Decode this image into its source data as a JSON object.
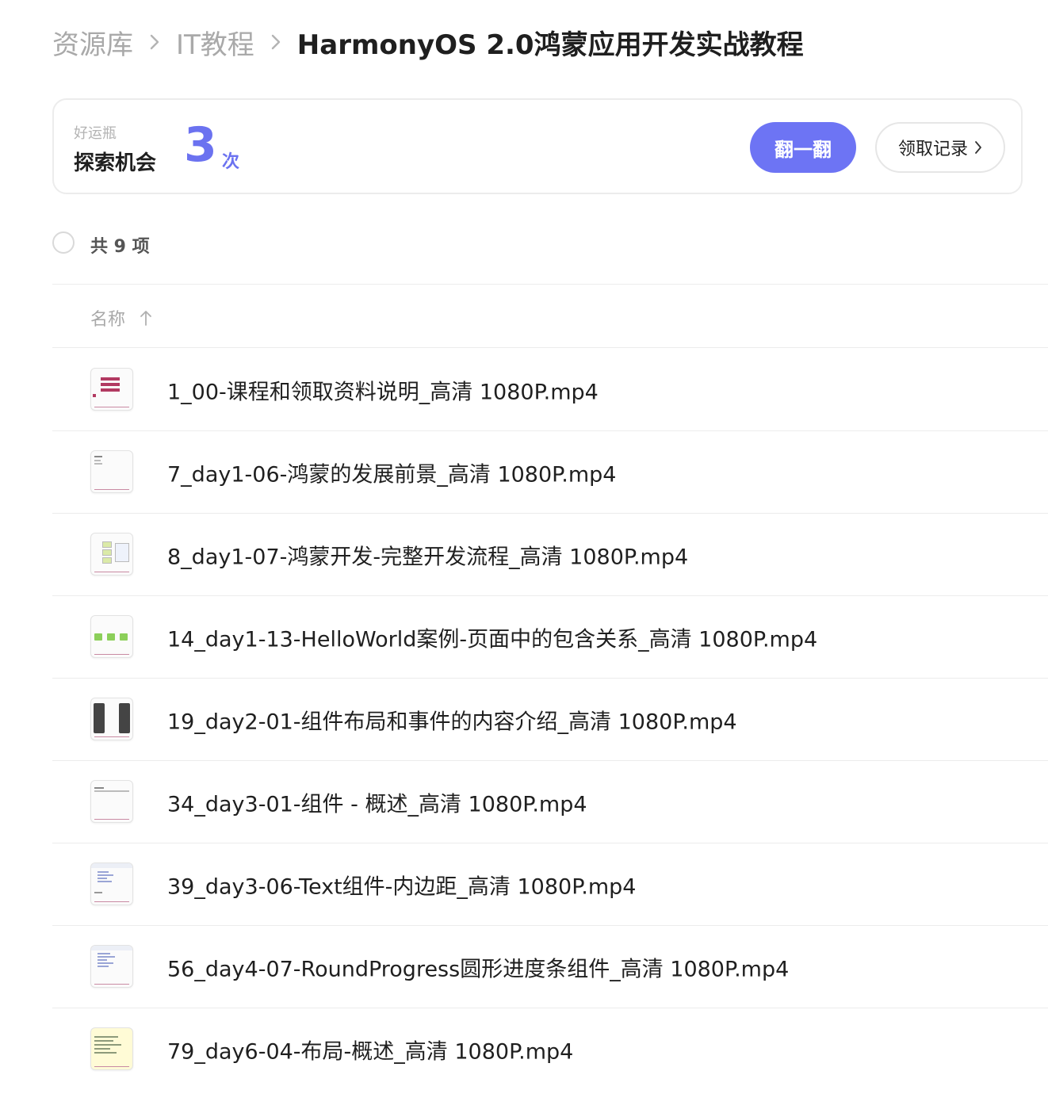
{
  "breadcrumb": {
    "items": [
      "资源库",
      "IT教程"
    ],
    "current": "HarmonyOS 2.0鸿蒙应用开发实战教程"
  },
  "lucky_card": {
    "subtitle": "好运瓶",
    "title": "探索机会",
    "count": "3",
    "count_unit": "次",
    "flip_button": "翻一翻",
    "record_button": "领取记录",
    "accent_color": "#6d74f4"
  },
  "list": {
    "total_text": "共 9 项",
    "column_name": "名称",
    "sort": "ascending",
    "files": [
      {
        "name": "1_00-课程和领取资料说明_高清 1080P.mp4",
        "thumb": "bars"
      },
      {
        "name": "7_day1-06-鸿蒙的发展前景_高清 1080P.mp4",
        "thumb": "doc"
      },
      {
        "name": "8_day1-07-鸿蒙开发-完整开发流程_高清 1080P.mp4",
        "thumb": "flow"
      },
      {
        "name": "14_day1-13-HelloWorld案例-页面中的包含关系_高清 1080P.mp4",
        "thumb": "green"
      },
      {
        "name": "19_day2-01-组件布局和事件的内容介绍_高清 1080P.mp4",
        "thumb": "phones"
      },
      {
        "name": "34_day3-01-组件 - 概述_高清 1080P.mp4",
        "thumb": "doc"
      },
      {
        "name": "39_day3-06-Text组件-内边距_高清 1080P.mp4",
        "thumb": "code"
      },
      {
        "name": "56_day4-07-RoundProgress圆形进度条组件_高清 1080P.mp4",
        "thumb": "code"
      },
      {
        "name": "79_day6-04-布局-概述_高清 1080P.mp4",
        "thumb": "yellow"
      }
    ]
  },
  "icons": {
    "breadcrumb_separator": "chevron-right-icon",
    "record_chevron": "chevron-right-icon",
    "sort": "arrow-up-icon",
    "file_thumbnail": "video-thumbnail-icon"
  }
}
